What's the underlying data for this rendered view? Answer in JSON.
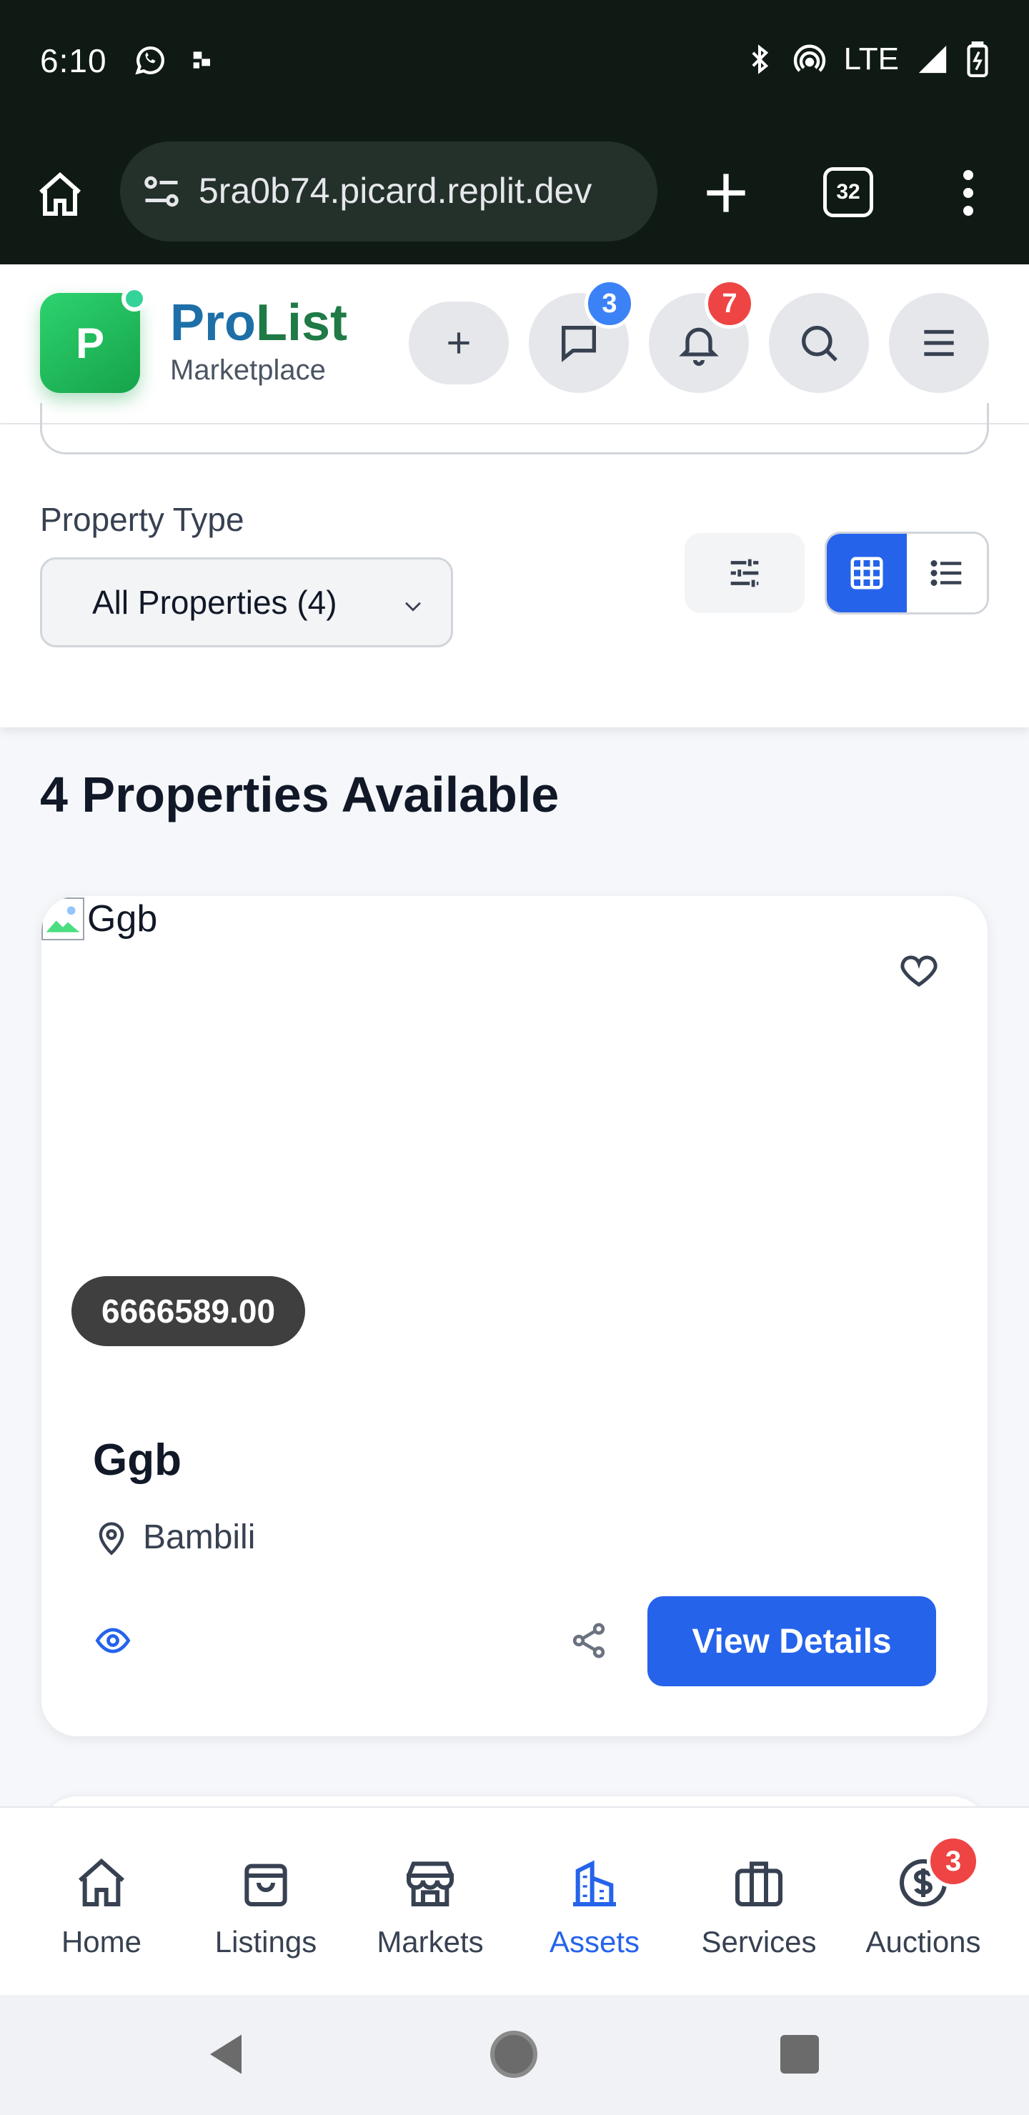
{
  "status_bar": {
    "time": "6:10",
    "network": "LTE"
  },
  "browser": {
    "url": "5ra0b74.picard.replit.dev",
    "tab_count": "32"
  },
  "header": {
    "logo_letter": "P",
    "brand_pro": "Pro",
    "brand_list": "List",
    "brand_sub": "Marketplace",
    "messages_badge": "3",
    "notifications_badge": "7",
    "colors": {
      "brand_green": "#1f7a46",
      "accent_blue": "#2563eb",
      "badge_red": "#ef4444"
    }
  },
  "filters": {
    "property_type_label": "Property Type",
    "property_type_value": "All Properties (4)",
    "view_mode": "grid"
  },
  "results": {
    "title": "4 Properties Available"
  },
  "listing": {
    "image_alt": "Ggb",
    "price": "6666589.00",
    "title": "Ggb",
    "location": "Bambili",
    "details_button": "View Details"
  },
  "bottom_nav": {
    "items": [
      {
        "label": "Home",
        "icon": "home-icon"
      },
      {
        "label": "Listings",
        "icon": "shopping-bag-icon"
      },
      {
        "label": "Markets",
        "icon": "store-icon"
      },
      {
        "label": "Assets",
        "icon": "building-icon",
        "active": true
      },
      {
        "label": "Services",
        "icon": "briefcase-icon"
      },
      {
        "label": "Auctions",
        "icon": "dollar-icon",
        "badge": "3"
      }
    ]
  }
}
